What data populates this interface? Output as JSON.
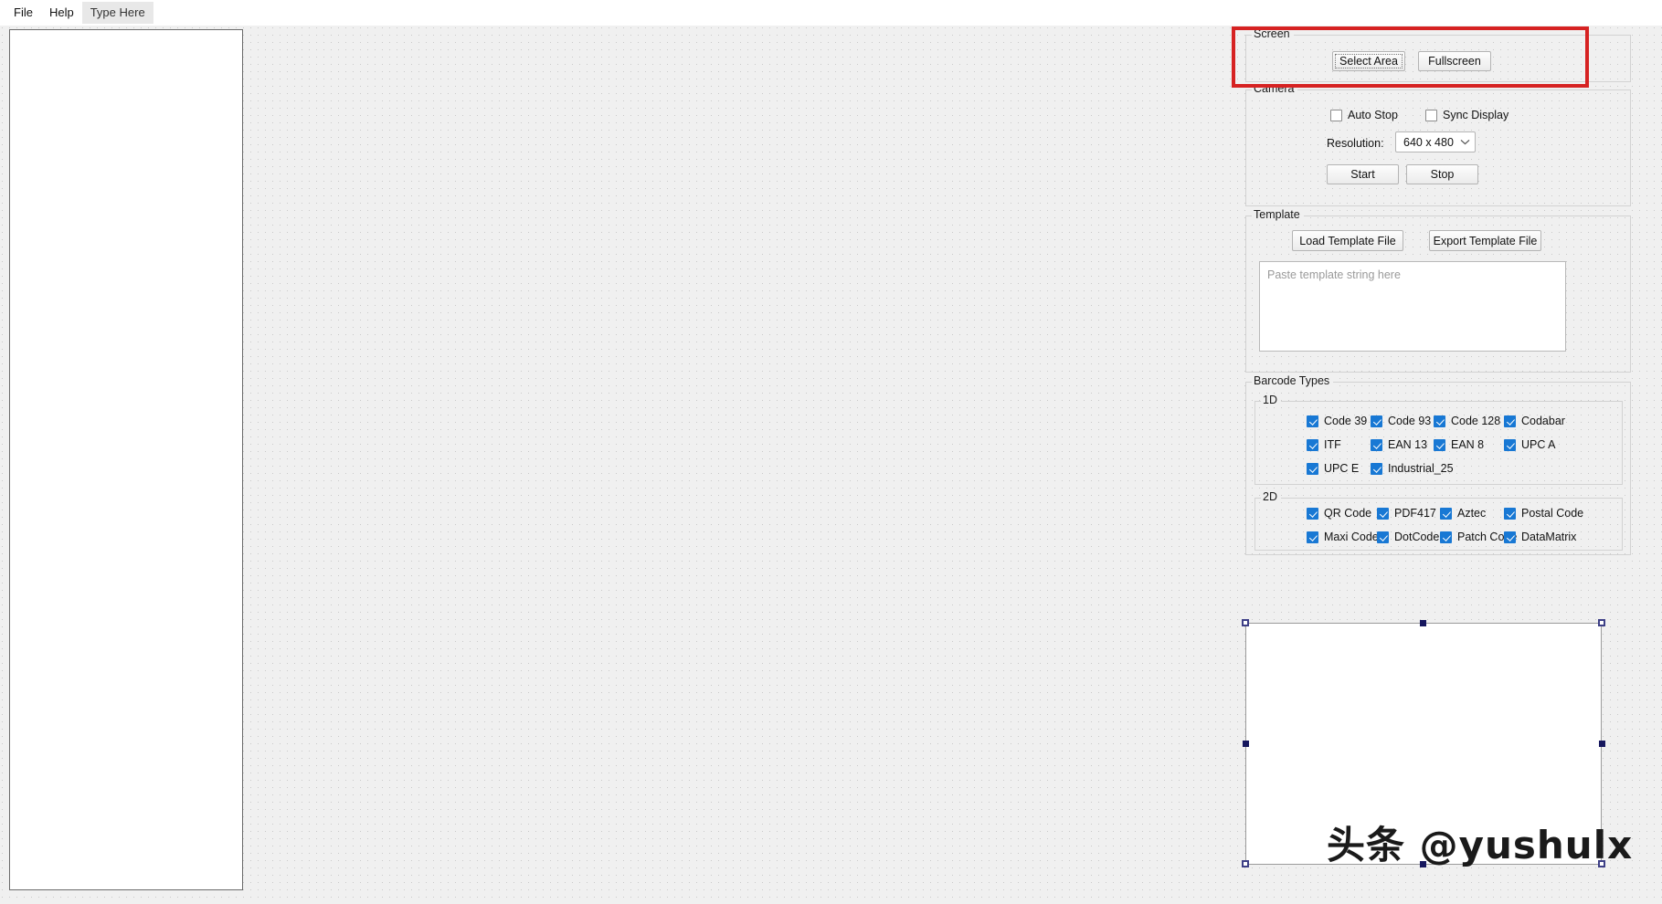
{
  "window": {
    "menu": [
      {
        "label": "File",
        "state": "normal"
      },
      {
        "label": "Help",
        "state": "normal"
      },
      {
        "label": "Type Here",
        "state": "placeholder"
      }
    ]
  },
  "screen_group": {
    "title": "Screen",
    "select_area_label": "Select Area",
    "fullscreen_label": "Fullscreen",
    "highlight_color": "#d62222"
  },
  "camera_group": {
    "title": "Camera",
    "auto_stop_label": "Auto Stop",
    "auto_stop_checked": false,
    "sync_display_label": "Sync Display",
    "sync_display_checked": false,
    "resolution_label": "Resolution:",
    "resolution_value": "640 x 480",
    "start_label": "Start",
    "stop_label": "Stop"
  },
  "template_group": {
    "title": "Template",
    "load_label": "Load Template File",
    "export_label": "Export Template File",
    "textarea_placeholder": "Paste template string here",
    "textarea_value": ""
  },
  "barcode_group": {
    "title": "Barcode Types",
    "oned": {
      "title": "1D",
      "items": [
        {
          "label": "Code 39",
          "checked": true
        },
        {
          "label": "Code 93",
          "checked": true
        },
        {
          "label": "Code 128",
          "checked": true
        },
        {
          "label": "Codabar",
          "checked": true
        },
        {
          "label": "ITF",
          "checked": true
        },
        {
          "label": "EAN 13",
          "checked": true
        },
        {
          "label": "EAN 8",
          "checked": true
        },
        {
          "label": "UPC A",
          "checked": true
        },
        {
          "label": "UPC E",
          "checked": true
        },
        {
          "label": "Industrial_25",
          "checked": true
        }
      ]
    },
    "twod": {
      "title": "2D",
      "items": [
        {
          "label": "QR Code",
          "checked": true
        },
        {
          "label": "PDF417",
          "checked": true
        },
        {
          "label": "Aztec",
          "checked": true
        },
        {
          "label": "Postal Code",
          "checked": true
        },
        {
          "label": "Maxi Code",
          "checked": true
        },
        {
          "label": "DotCode",
          "checked": true
        },
        {
          "label": "Patch Code",
          "checked": true
        },
        {
          "label": "DataMatrix",
          "checked": true
        }
      ]
    },
    "checkbox_accent": "#1878d4"
  },
  "preview_panel": {
    "watermark": "头条 @yushulx",
    "selected": true
  }
}
